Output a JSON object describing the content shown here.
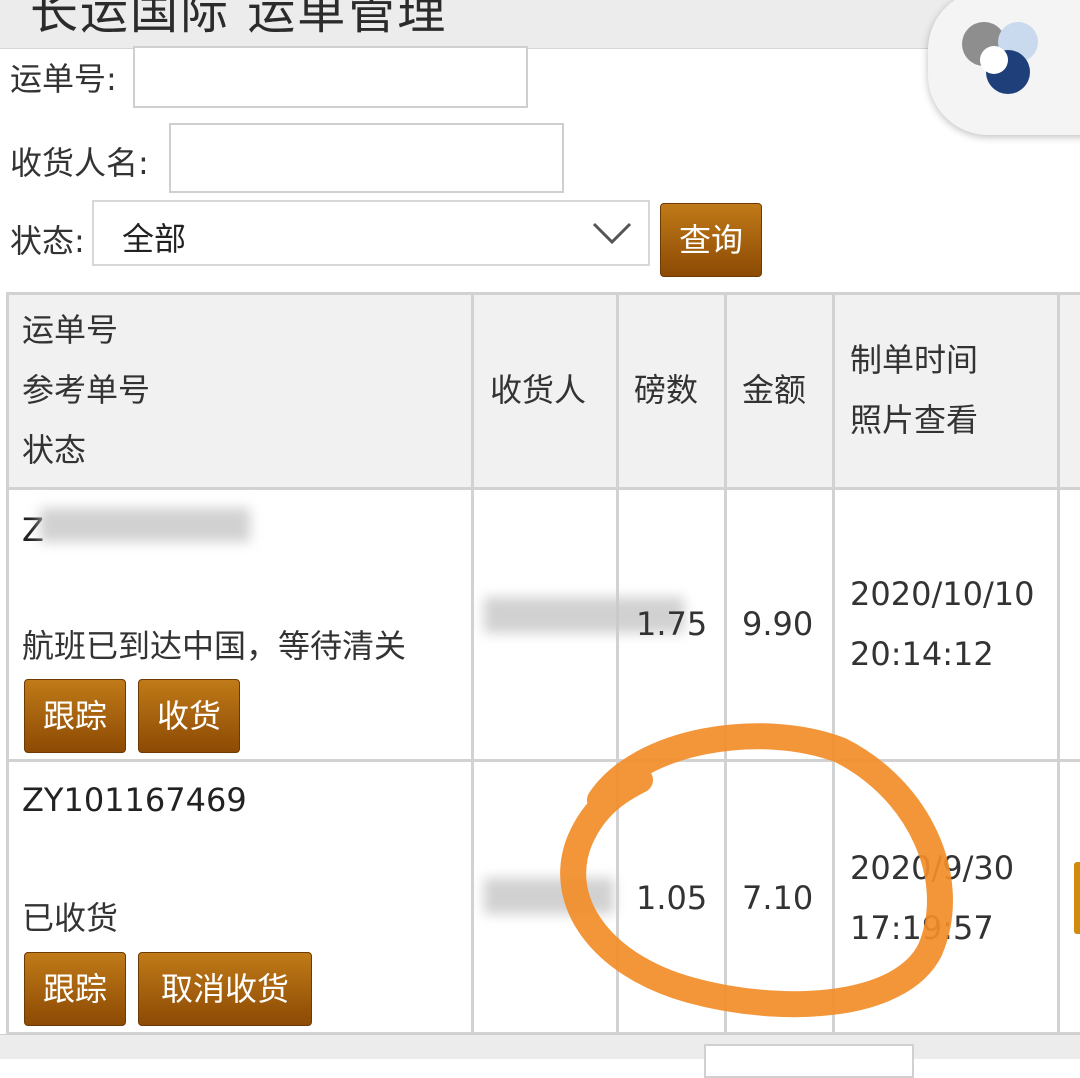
{
  "header": {
    "title": "长运国际 运单管理"
  },
  "search": {
    "waybill_label": "运单号:",
    "waybill_value": "",
    "receiver_label": "收货人名:",
    "receiver_value": "",
    "status_label": "状态:",
    "status_selected": "全部",
    "query_button": "查询"
  },
  "table": {
    "headers": {
      "col1": [
        "运单号",
        "参考单号",
        "状态"
      ],
      "col2": "收货人",
      "col3": "磅数",
      "col4": "金额",
      "col5": [
        "制单时间",
        "照片查看"
      ]
    },
    "rows": [
      {
        "waybill_no": "Z",
        "status": "航班已到达中国，等待清关",
        "weight": "1.75",
        "amount": "9.90",
        "date": "2020/10/10",
        "time": "20:14:12",
        "buttons": [
          "跟踪",
          "收货"
        ]
      },
      {
        "waybill_no": "ZY101167469",
        "status": "已收货",
        "weight": "1.05",
        "amount": "7.10",
        "date": "2020/9/30",
        "time": "17:19:57",
        "buttons": [
          "跟踪",
          "取消收货"
        ]
      }
    ]
  },
  "colors": {
    "button": "#a3600c",
    "annotation": "#f28c28",
    "grid": "#d2d2d2"
  },
  "icons": [
    "chevron-down-icon",
    "assistive-touch-icon"
  ]
}
